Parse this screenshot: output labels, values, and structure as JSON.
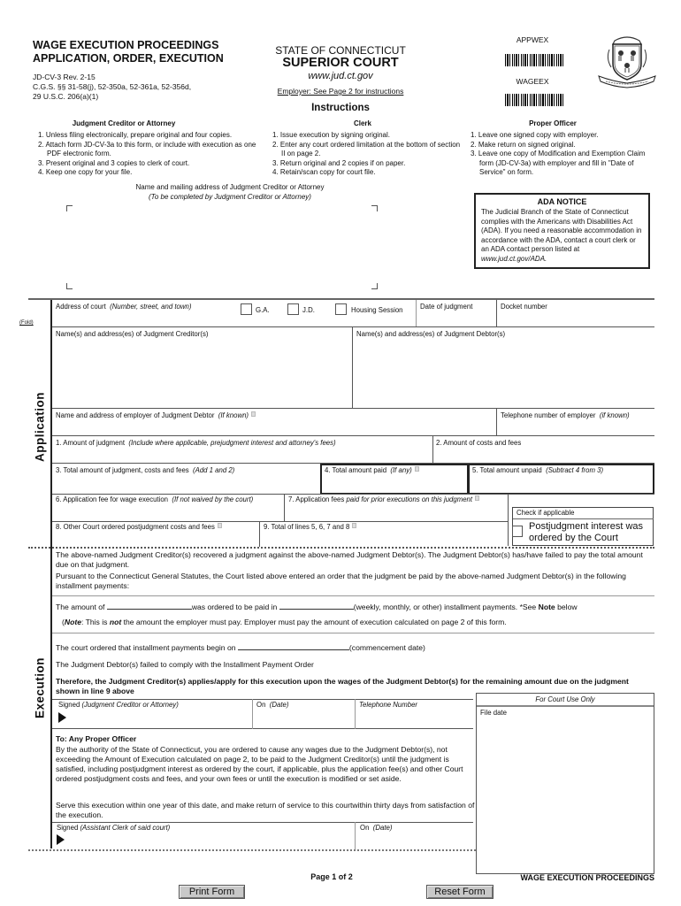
{
  "header": {
    "title_line1": "WAGE EXECUTION PROCEEDINGS",
    "title_line2": "APPLICATION, ORDER, EXECUTION",
    "form_id": "JD-CV-3   Rev. 2-15",
    "statutes_line1": "C.G.S. §§ 31-58(j), 52-350a, 52-361a, 52-356d,",
    "statutes_line2": "29 U.S.C. 206(a)(1)",
    "state": "STATE OF CONNECTICUT",
    "court": "SUPERIOR COURT",
    "website": "www.jud.ct.gov",
    "employer_note": "Employer: See Page 2 for instructions",
    "instructions_title": "Instructions",
    "barcode1_label": "APPWEX",
    "barcode2_label": "WAGEEX",
    "seal_icon": "connecticut-state-seal"
  },
  "instructions": {
    "creditor": {
      "heading": "Judgment Creditor or Attorney",
      "items": [
        "1. Unless filing electronically, prepare original and four copies.",
        "2. Attach form JD-CV-3a to this form, or include with execution as one PDF electronic form.",
        "3. Present original and 3 copies to clerk of court.",
        "4. Keep one copy for your file."
      ]
    },
    "clerk": {
      "heading": "Clerk",
      "items": [
        "1. Issue execution by signing original.",
        "2. Enter any court ordered limitation at the bottom of section II on page 2.",
        "3. Return original and 2 copies if on paper.",
        "4. Retain/scan copy for court file."
      ]
    },
    "officer": {
      "heading": "Proper Officer",
      "items": [
        "1. Leave one signed copy with employer.",
        "2. Make return on signed original.",
        "3. Leave one copy of Modification and Exemption Claim form (JD-CV-3a) with employer and fill in \"Date of Service\" on form."
      ]
    },
    "mailing_label": "Name and mailing address of Judgment Creditor or Attorney",
    "mailing_sub": "(To be completed by Judgment Creditor or Attorney)"
  },
  "ada": {
    "heading": "ADA NOTICE",
    "text": "The Judicial Branch of the State of Connecticut complies with the Americans with Disabilities Act (ADA). If you need a reasonable accommodation in accordance with the ADA, contact a court clerk or an ADA contact person listed at ",
    "link": "www.jud.ct.gov/ADA."
  },
  "fold_label": "(Fold)",
  "application": {
    "section_label": "Application",
    "court_address": "Address of court",
    "court_address_hint": "(Number, street, and town)",
    "ga": "G.A.",
    "jd": "J.D.",
    "housing": "Housing Session",
    "date_of_judgment": "Date of judgment",
    "docket_number": "Docket number",
    "creditors": "Name(s) and address(es) of Judgment Creditor(s)",
    "debtors": "Name(s) and address(es) of Judgment Debtor(s)",
    "employer": "Name and address of employer of Judgment Debtor",
    "employer_hint": "(If known)",
    "employer_phone": "Telephone number of employer",
    "employer_phone_hint": "(if known)",
    "line1": "1. Amount of judgment",
    "line1_hint": "(Include where applicable, prejudgment interest and attorney's fees)",
    "line2": "2. Amount of costs and fees",
    "line3": "3. Total amount of judgment, costs and fees",
    "line3_hint": "(Add 1 and 2)",
    "line4": "4. Total amount paid",
    "line4_hint": "(If any)",
    "line5": "5. Total amount unpaid",
    "line5_hint": "(Subtract 4 from 3)",
    "line6": "6. Application fee for wage execution",
    "line6_hint": "(If not waived by the court)",
    "line7": "7. Application fees",
    "line7_hint": "paid for prior executions on this judgment",
    "line8": "8. Other Court ordered postjudgment costs and fees",
    "line9": "9. Total of lines 5, 6, 7 and 8",
    "check_if_applicable": "Check if applicable",
    "postjudgment_interest_1": "Postjudgment interest was",
    "postjudgment_interest_2": "ordered by the Court"
  },
  "execution": {
    "section_label": "Execution",
    "para1": "The above-named Judgment Creditor(s) recovered a judgment against the above-named Judgment Debtor(s).  The Judgment Debtor(s) has/have failed to pay the total amount due on that judgment.",
    "para2": "Pursuant to the Connecticut General Statutes, the Court listed above entered an order that the judgment be paid by the above-named Judgment Debtor(s) in the following installment payments:",
    "amount_of": "The amount of",
    "ordered_paid": "was ordered to be paid in",
    "installments": "(weekly, monthly, or other) installment payments. *See ",
    "note_word": "Note",
    "below": " below",
    "note_open": "(",
    "note_label": "Note",
    "note_a": ": This is ",
    "note_not": "not",
    "note_b": " the amount the employer must pay.  Employer must pay the amount of execution calculated on page 2 of this form.",
    "begin_on": "The court ordered that installment payments begin on",
    "commencement": "(commencement date)",
    "failed": "The Judgment Debtor(s) failed to comply with the Installment Payment Order",
    "therefore": "Therefore, the Judgment Creditor(s) applies/apply for this execution upon the wages of the Judgment Debtor(s)  for the remaining amount due on the judgment shown in line 9 above",
    "signed": "Signed",
    "signed_hint": "(Judgment Creditor or Attorney)",
    "on": "On",
    "on_hint": "(Date)",
    "phone": "Telephone Number",
    "court_use": "For Court Use Only",
    "file_date": "File date",
    "to_officer": "To: Any Proper Officer",
    "authority": "By the authority of the State of Connecticut, you are ordered to cause any wages due to the Judgment Debtor(s), not exceeding the Amount of Execution calculated on page 2, to be paid to the Judgment Creditor(s) until the judgment is satisfied, including postjudgment interest as ordered by the court, if applicable, plus the application fee(s) and other Court ordered postjudgment costs and fees, and your own fees or until the execution is modified or set aside.",
    "serve": "Serve this execution within one year of this date, and make return of service to this courtwithin thirty days from satisfaction of the execution.",
    "clerk_signed": "Signed",
    "clerk_signed_hint": "(Assistant Clerk of said court)",
    "clerk_on": "On",
    "clerk_on_hint": "(Date)"
  },
  "footer": {
    "page": "Page 1 of 2",
    "form_name": "WAGE EXECUTION PROCEEDINGS",
    "print_button": "Print Form",
    "reset_button": "Reset Form"
  }
}
